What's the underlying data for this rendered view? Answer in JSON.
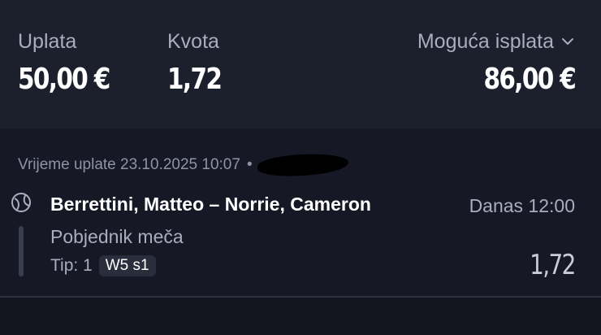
{
  "summary": {
    "stake_label": "Uplata",
    "stake_value": "50,00 €",
    "odds_label": "Kvota",
    "odds_value": "1,72",
    "payout_label": "Moguća isplata",
    "payout_value": "86,00 €",
    "payout_toggle_icon": "chevron-down-icon"
  },
  "ticket": {
    "timestamp": "Vrijeme uplate 23.10.2025 10:07",
    "separator": "•",
    "sport_icon": "tennis-ball-icon",
    "selection": {
      "match": "Berrettini, Matteo – Norrie, Cameron",
      "start_time": "Danas 12:00",
      "market": "Pobjednik meča",
      "tip_label": "Tip: 1",
      "tip_code": "W5 s1",
      "odds": "1,72"
    }
  },
  "colors": {
    "background": "#13151f",
    "summary_background": "#1c1f2c",
    "muted_text": "#a9adbd",
    "primary_text": "#ffffff"
  }
}
